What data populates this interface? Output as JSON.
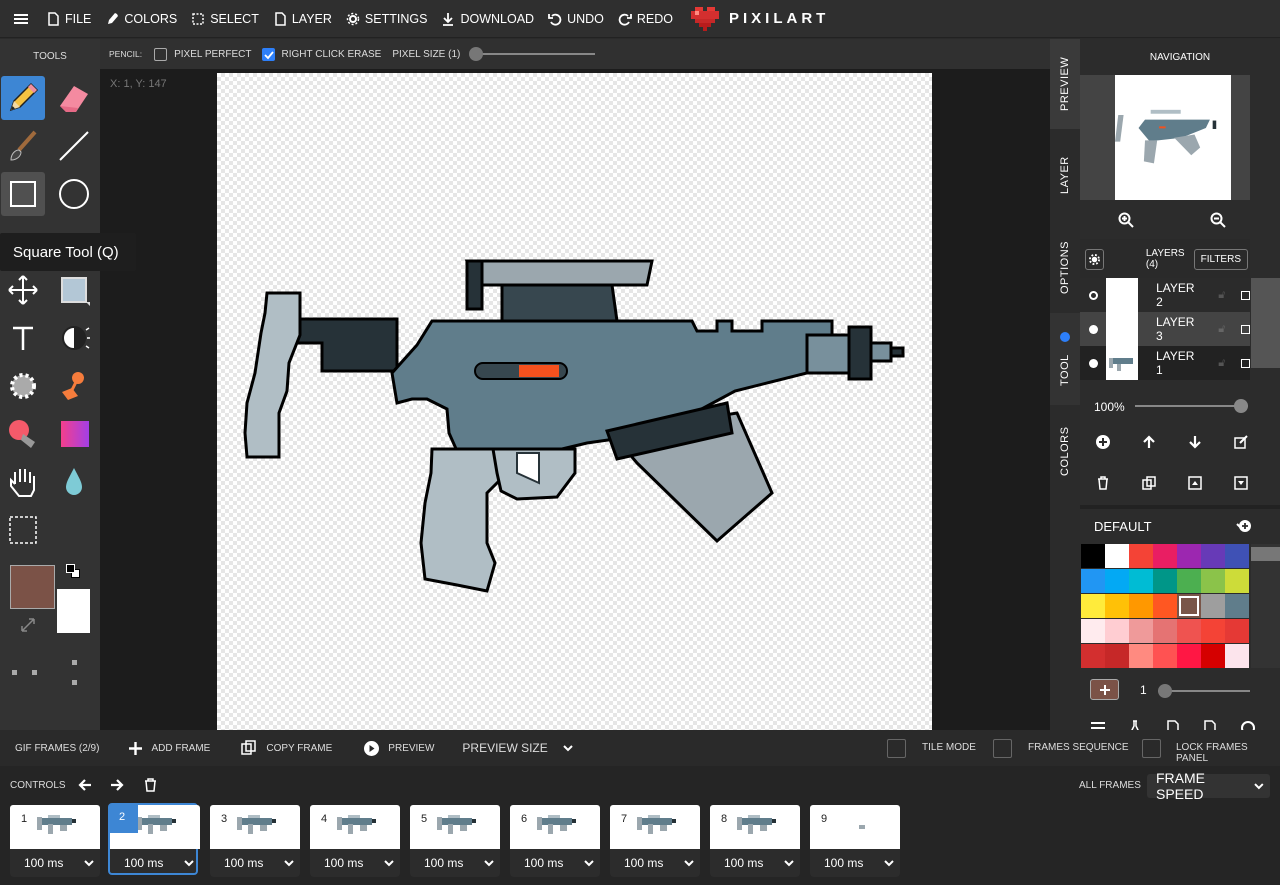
{
  "topbar": {
    "file": "FILE",
    "colors": "COLORS",
    "select": "SELECT",
    "layer": "LAYER",
    "settings": "SETTINGS",
    "download": "DOWNLOAD",
    "undo": "UNDO",
    "redo": "REDO",
    "logo": "PIXILART"
  },
  "tools": {
    "title": "TOOLS",
    "tooltip": "Square Tool (Q)",
    "primary_color": "#7b5247",
    "secondary_color": "#ffffff"
  },
  "options": {
    "tool_name": "PENCIL:",
    "pixel_perfect": "PIXEL PERFECT",
    "right_click_erase": "RIGHT CLICK ERASE",
    "pixel_size": "PIXEL SIZE (1)",
    "pixel_size_value": 1
  },
  "canvas": {
    "coords": "X: 1, Y: 147"
  },
  "side_tabs": {
    "preview": "PREVIEW",
    "layer": "LAYER",
    "options": "OPTIONS",
    "tool": "TOOL",
    "colors": "COLORS"
  },
  "navigation": {
    "title": "NAVIGATION"
  },
  "layers": {
    "title": "LAYERS (4)",
    "filters": "FILTERS",
    "items": [
      {
        "name": "LAYER 2"
      },
      {
        "name": "LAYER 3"
      },
      {
        "name": "LAYER 1"
      }
    ],
    "opacity": "100%"
  },
  "palette": {
    "name": "DEFAULT",
    "brush_size": "1",
    "colors": [
      "#000000",
      "#ffffff",
      "#f44336",
      "#e91e63",
      "#9c27b0",
      "#673ab7",
      "#3f51b5",
      "#2196f3",
      "#03a9f4",
      "#00bcd4",
      "#009688",
      "#4caf50",
      "#8bc34a",
      "#cddc39",
      "#ffeb3b",
      "#ffc107",
      "#ff9800",
      "#ff5722",
      "#795548",
      "#9e9e9e",
      "#607d8b",
      "#ffebee",
      "#ffcdd2",
      "#ef9a9a",
      "#e57373",
      "#ef5350",
      "#f44336",
      "#e53935",
      "#d32f2f",
      "#c62828",
      "#ff8a80",
      "#ff5252",
      "#ff1744",
      "#d50000",
      "#fce4ec"
    ]
  },
  "gif": {
    "frames_label": "GIF FRAMES (2/9)",
    "add_frame": "ADD FRAME",
    "copy_frame": "COPY FRAME",
    "preview": "PREVIEW",
    "preview_size": "PREVIEW SIZE",
    "tile_mode": "TILE MODE",
    "frames_sequence": "FRAMES SEQUENCE",
    "lock_frames_panel": "LOCK FRAMES PANEL",
    "controls": "CONTROLS",
    "all_frames": "ALL FRAMES",
    "frame_speed": "FRAME SPEED"
  },
  "frames": [
    {
      "num": "1",
      "speed": "100 ms"
    },
    {
      "num": "2",
      "speed": "100 ms"
    },
    {
      "num": "3",
      "speed": "100 ms"
    },
    {
      "num": "4",
      "speed": "100 ms"
    },
    {
      "num": "5",
      "speed": "100 ms"
    },
    {
      "num": "6",
      "speed": "100 ms"
    },
    {
      "num": "7",
      "speed": "100 ms"
    },
    {
      "num": "8",
      "speed": "100 ms"
    },
    {
      "num": "9",
      "speed": "100 ms"
    }
  ]
}
